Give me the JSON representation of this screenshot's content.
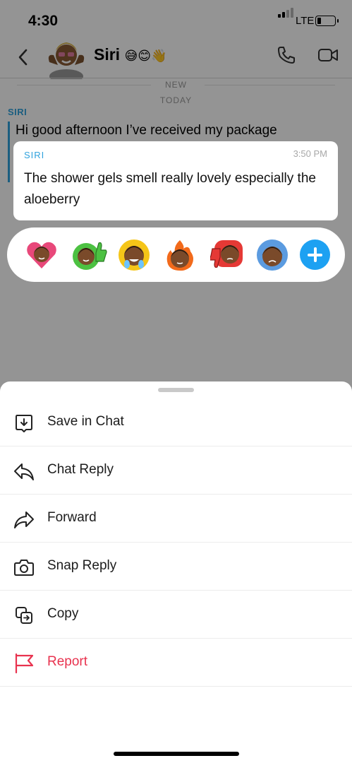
{
  "status_bar": {
    "time": "4:30",
    "network": "LTE"
  },
  "header": {
    "contact_name": "Siri",
    "contact_emojis": "😅😊👋"
  },
  "chat": {
    "divider_new": "NEW",
    "divider_today": "TODAY",
    "sender": "SIRI",
    "message_preview": "Hi good afternoon I’ve received my package"
  },
  "selected_message": {
    "sender": "SIRI",
    "time": "3:50 PM",
    "text": "The shower gels smell really lovely especially the aloeberry"
  },
  "reactions": [
    {
      "icon": "heart-bitmoji-icon",
      "color": "#e8487a"
    },
    {
      "icon": "thumbs-up-bitmoji-icon",
      "color": "#4cc142"
    },
    {
      "icon": "laughing-bitmoji-icon",
      "color": "#f5c518"
    },
    {
      "icon": "fire-bitmoji-icon",
      "color": "#f26a1b"
    },
    {
      "icon": "thumbs-down-bitmoji-icon",
      "color": "#e53935"
    },
    {
      "icon": "sad-bitmoji-icon",
      "color": "#5b9be0"
    },
    {
      "icon": "add-reaction-icon",
      "color": "#1da1f2"
    }
  ],
  "actions": [
    {
      "label": "Save in Chat",
      "icon": "save-in-chat-icon"
    },
    {
      "label": "Chat Reply",
      "icon": "reply-arrow-icon"
    },
    {
      "label": "Forward",
      "icon": "forward-arrow-icon"
    },
    {
      "label": "Snap Reply",
      "icon": "camera-icon"
    },
    {
      "label": "Copy",
      "icon": "copy-icon"
    },
    {
      "label": "Report",
      "icon": "flag-icon",
      "color": "#e8334f"
    }
  ]
}
